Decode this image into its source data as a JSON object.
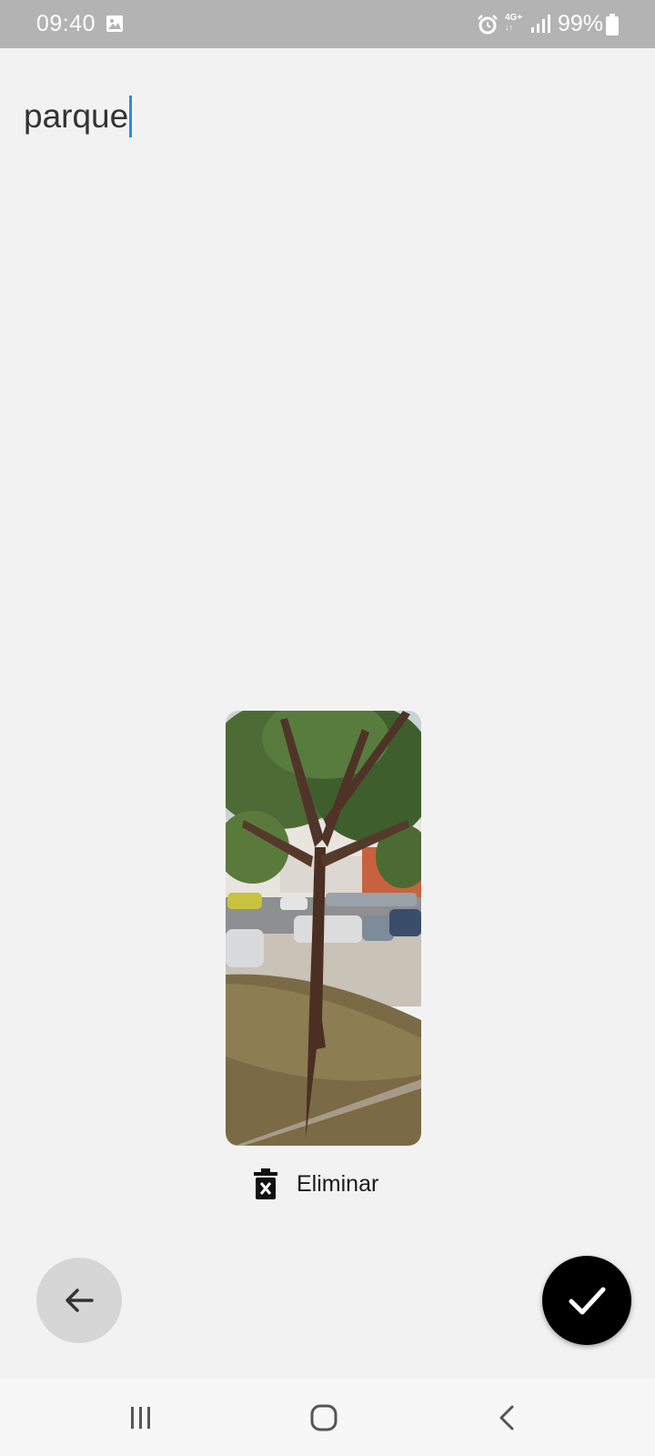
{
  "status_bar": {
    "time": "09:40",
    "network": "4G+",
    "battery": "99%",
    "icons": [
      "gallery-icon",
      "alarm-icon",
      "network-4g-icon",
      "signal-icon",
      "battery-icon"
    ]
  },
  "note": {
    "title_value": "parque"
  },
  "attachment": {
    "delete_label": "Eliminar",
    "delete_icon": "trash-x-icon"
  },
  "actions": {
    "back_icon": "arrow-left-icon",
    "confirm_icon": "check-icon",
    "back_bg": "#d6d6d6",
    "confirm_bg": "#000000"
  },
  "nav": {
    "icons": [
      "recents-icon",
      "home-icon",
      "back-icon"
    ]
  },
  "colors": {
    "background": "#f2f2f2",
    "status_bar": "#b3b3b3",
    "caret": "#2b8be6"
  }
}
